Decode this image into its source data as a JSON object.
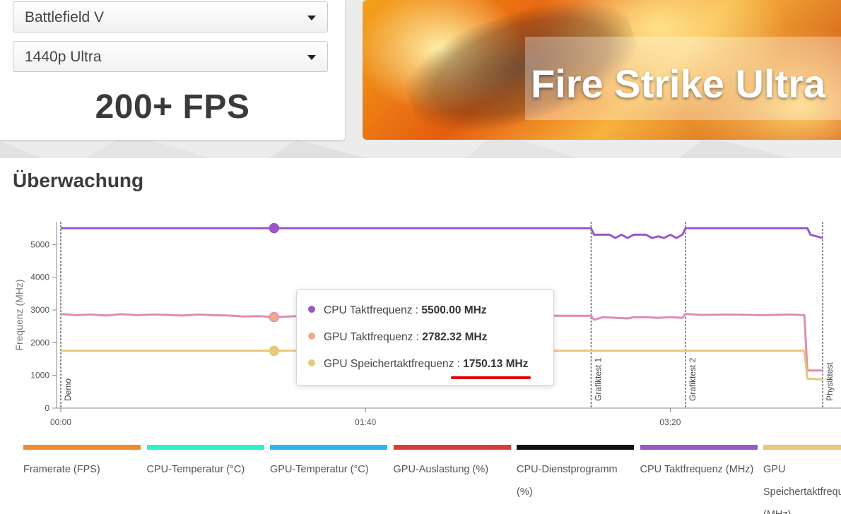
{
  "selectors": {
    "game": "Battlefield V",
    "preset": "1440p Ultra"
  },
  "fps_result": "200+ FPS",
  "banner": {
    "title": "Fire Strike Ultra"
  },
  "section_title": "Überwachung",
  "chart_data": {
    "type": "line",
    "ylabel": "Frequenz (MHz)",
    "ylim": [
      0,
      6000
    ],
    "yticks": [
      "0",
      "1000",
      "2000",
      "3000",
      "4000",
      "5000"
    ],
    "xticks": [
      "00:00",
      "01:40",
      "03:20"
    ],
    "x_unit": "seconds",
    "xlim": [
      0,
      250
    ],
    "phases": [
      {
        "name": "Demo",
        "x": 0
      },
      {
        "name": "Grafiktest 1",
        "x": 174
      },
      {
        "name": "Grafiktest 2",
        "x": 205
      },
      {
        "name": "Physiktest",
        "x": 250
      }
    ],
    "series": [
      {
        "name": "CPU Taktfrequenz (MHz)",
        "color": "#9b55c9",
        "points": [
          [
            0,
            5500
          ],
          [
            174,
            5500
          ],
          [
            175,
            5300
          ],
          [
            180,
            5300
          ],
          [
            182,
            5200
          ],
          [
            184,
            5300
          ],
          [
            186,
            5200
          ],
          [
            188,
            5300
          ],
          [
            192,
            5300
          ],
          [
            194,
            5200
          ],
          [
            196,
            5250
          ],
          [
            198,
            5200
          ],
          [
            200,
            5300
          ],
          [
            202,
            5200
          ],
          [
            204,
            5300
          ],
          [
            205,
            5500
          ],
          [
            245,
            5500
          ],
          [
            246,
            5300
          ],
          [
            250,
            5200
          ]
        ]
      },
      {
        "name": "GPU Taktfrequenz (MHz)",
        "color": "#e28bb4",
        "points": [
          [
            0,
            2880
          ],
          [
            5,
            2840
          ],
          [
            10,
            2860
          ],
          [
            15,
            2830
          ],
          [
            20,
            2870
          ],
          [
            25,
            2840
          ],
          [
            30,
            2860
          ],
          [
            35,
            2850
          ],
          [
            40,
            2830
          ],
          [
            45,
            2860
          ],
          [
            50,
            2840
          ],
          [
            55,
            2830
          ],
          [
            60,
            2800
          ],
          [
            65,
            2810
          ],
          [
            70,
            2782
          ],
          [
            75,
            2800
          ],
          [
            80,
            2820
          ],
          [
            100,
            2820
          ],
          [
            120,
            2830
          ],
          [
            140,
            2810
          ],
          [
            160,
            2820
          ],
          [
            174,
            2820
          ],
          [
            175,
            2700
          ],
          [
            178,
            2780
          ],
          [
            182,
            2760
          ],
          [
            186,
            2740
          ],
          [
            188,
            2780
          ],
          [
            192,
            2780
          ],
          [
            196,
            2760
          ],
          [
            200,
            2780
          ],
          [
            204,
            2760
          ],
          [
            205,
            2880
          ],
          [
            210,
            2850
          ],
          [
            220,
            2860
          ],
          [
            230,
            2840
          ],
          [
            240,
            2860
          ],
          [
            244,
            2840
          ],
          [
            245,
            1150
          ],
          [
            250,
            1150
          ]
        ]
      },
      {
        "name": "GPU Speichertaktfrequenz (MHz)",
        "color": "#e8c87a",
        "points": [
          [
            0,
            1750
          ],
          [
            174,
            1750
          ],
          [
            205,
            1750
          ],
          [
            244,
            1750
          ],
          [
            245,
            900
          ],
          [
            250,
            880
          ]
        ]
      }
    ],
    "hover": {
      "x": 70,
      "cpu": {
        "label": "CPU Taktfrequenz : ",
        "value": "5500.00 MHz"
      },
      "gpu": {
        "label": "GPU Taktfrequenz : ",
        "value": "2782.32 MHz"
      },
      "mem": {
        "label": "GPU Speichertaktfrequenz : ",
        "value": "1750.13 MHz"
      }
    }
  },
  "legend": [
    {
      "label": "Framerate (FPS)",
      "color": "#f08a2e"
    },
    {
      "label": "CPU-Temperatur (°C)",
      "color": "#31f0c8"
    },
    {
      "label": "GPU-Temperatur (°C)",
      "color": "#2bb5ee"
    },
    {
      "label": "GPU-Auslastung (%)",
      "color": "#d93c3c"
    },
    {
      "label": "CPU-Dienstprogramm (%)",
      "color": "#111111"
    },
    {
      "label": "CPU Taktfrequenz (MHz)",
      "color": "#9b55c9"
    },
    {
      "label": "GPU Speichertaktfrequenz (MHz)",
      "color": "#e8c87a"
    }
  ]
}
